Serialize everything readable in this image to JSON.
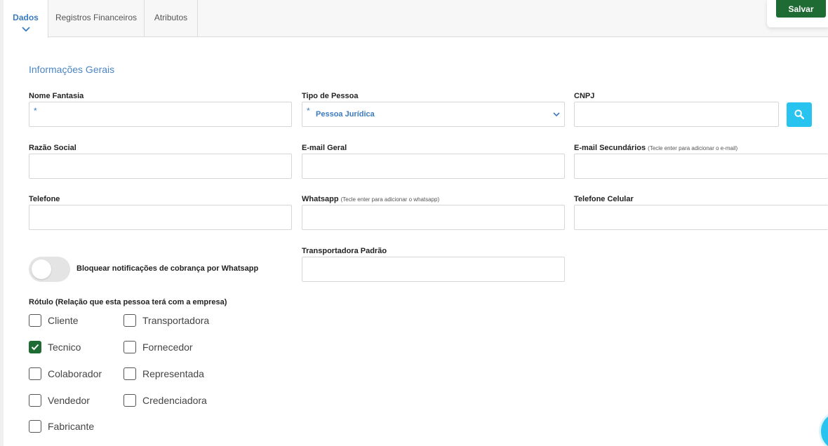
{
  "tabs": [
    {
      "label": "Dados",
      "active": true
    },
    {
      "label": "Registros Financeiros",
      "active": false
    },
    {
      "label": "Atributos",
      "active": false
    }
  ],
  "toolbar": {
    "save_label": "Salvar"
  },
  "section": {
    "title": "Informações Gerais"
  },
  "fields": {
    "nome_fantasia": {
      "label": "Nome Fantasia",
      "required_mark": "*",
      "value": ""
    },
    "tipo_pessoa": {
      "label": "Tipo de Pessoa",
      "required_mark": "*",
      "value": "Pessoa Jurídica"
    },
    "cnpj": {
      "label": "CNPJ",
      "value": ""
    },
    "razao_social": {
      "label": "Razão Social",
      "value": ""
    },
    "email_geral": {
      "label": "E-mail Geral",
      "value": ""
    },
    "email_secundarios": {
      "label": "E-mail Secundários",
      "hint": "(Tecle enter para adicionar o e-mail)",
      "value": ""
    },
    "telefone": {
      "label": "Telefone",
      "value": ""
    },
    "whatsapp": {
      "label": "Whatsapp",
      "hint": "(Tecle enter para adicionar o whatsapp)",
      "value": ""
    },
    "telefone_celular": {
      "label": "Telefone Celular",
      "value": ""
    },
    "transportadora_padrao": {
      "label": "Transportadora Padrão",
      "value": ""
    }
  },
  "toggle": {
    "label": "Bloquear notificações de cobrança por Whatsapp",
    "on": false
  },
  "rotulo": {
    "label": "Rótulo (Relação que esta pessoa terá com a empresa)",
    "options": [
      {
        "label": "Cliente",
        "checked": false
      },
      {
        "label": "Tecnico",
        "checked": true
      },
      {
        "label": "Colaborador",
        "checked": false
      },
      {
        "label": "Vendedor",
        "checked": false
      },
      {
        "label": "Fabricante",
        "checked": false
      },
      {
        "label": "Transportadora",
        "checked": false
      },
      {
        "label": "Fornecedor",
        "checked": false
      },
      {
        "label": "Representada",
        "checked": false
      },
      {
        "label": "Credenciadora",
        "checked": false
      }
    ]
  },
  "colors": {
    "accent": "#3b7bbf",
    "primary_button": "#1e6b34",
    "search_button": "#29c3ef"
  }
}
